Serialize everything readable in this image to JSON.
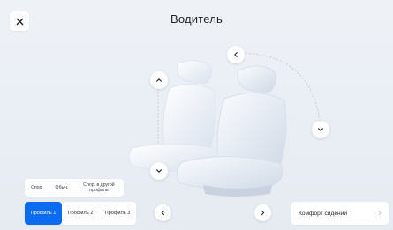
{
  "header": {
    "title": "Водитель"
  },
  "icons": {
    "close": "close-icon",
    "backrest_up": "chevron-up-icon",
    "backrest_down": "chevron-down-icon",
    "recline_back": "chevron-left-icon",
    "recline_forward": "chevron-down-icon",
    "prev_profile": "chevron-left-icon",
    "next_profile": "chevron-right-icon",
    "comfort_arrow": "chevron-right-icon"
  },
  "seat_modes": {
    "items": [
      {
        "label": "Спор."
      },
      {
        "label": "Обыч."
      },
      {
        "label": "Спор. в другой профиль"
      }
    ]
  },
  "profiles": {
    "items": [
      {
        "label": "Профиль 1",
        "active": true
      },
      {
        "label": "Профиль 2",
        "active": false
      },
      {
        "label": "Профиль 3",
        "active": false
      }
    ]
  },
  "comfort": {
    "label": "Комфорт сидений"
  },
  "colors": {
    "accent": "#0b6cf0",
    "background": "#eef2f7",
    "panel": "#ffffff",
    "text": "#1f2329"
  }
}
